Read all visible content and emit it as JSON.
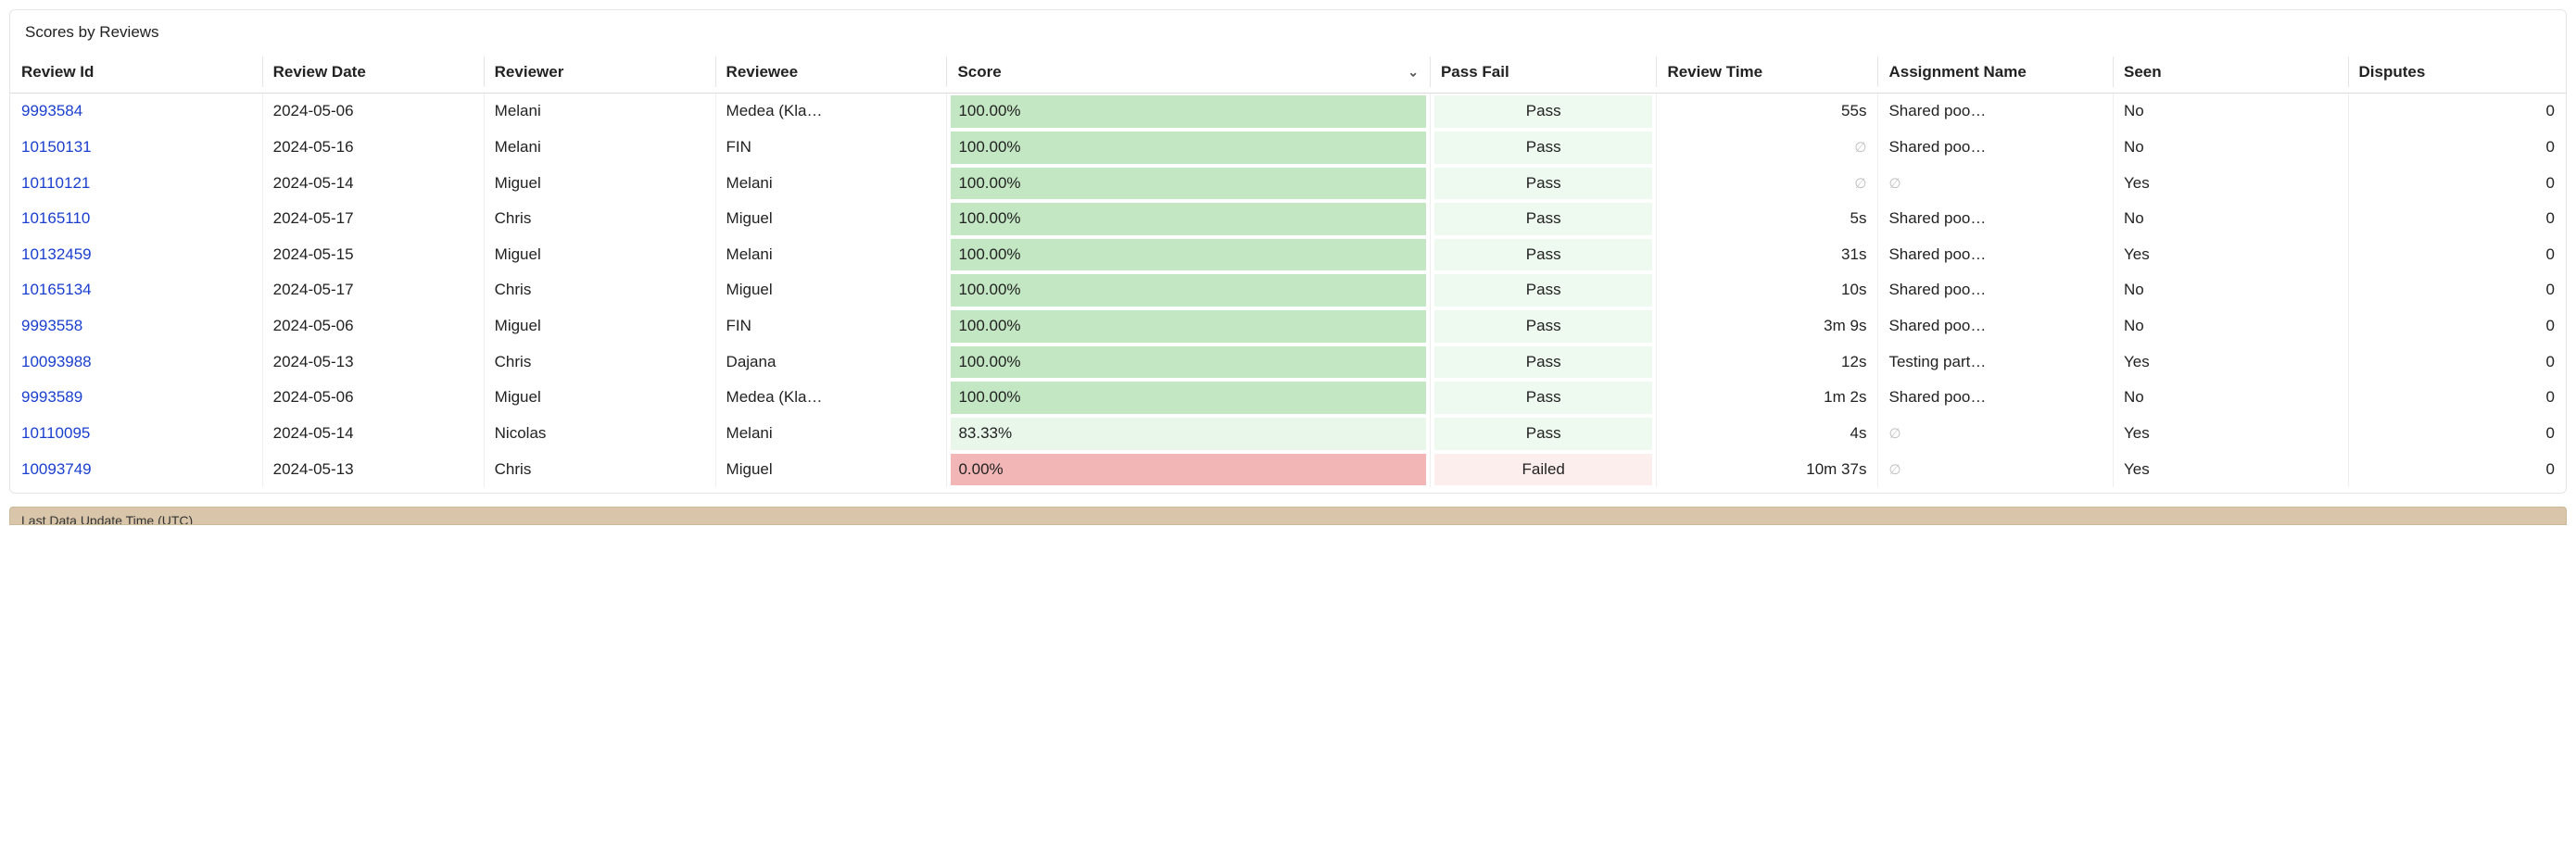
{
  "panel": {
    "title": "Scores by Reviews"
  },
  "columns": [
    {
      "key": "review_id",
      "label": "Review Id",
      "sorted": false,
      "class": "col-reviewid"
    },
    {
      "key": "review_date",
      "label": "Review Date",
      "sorted": false,
      "class": "col-reviewdate"
    },
    {
      "key": "reviewer",
      "label": "Reviewer",
      "sorted": false,
      "class": "col-reviewer"
    },
    {
      "key": "reviewee",
      "label": "Reviewee",
      "sorted": false,
      "class": "col-reviewee"
    },
    {
      "key": "score",
      "label": "Score",
      "sorted": true,
      "class": "col-score"
    },
    {
      "key": "pass_fail",
      "label": "Pass Fail",
      "sorted": false,
      "class": "col-passfail"
    },
    {
      "key": "review_time",
      "label": "Review Time",
      "sorted": false,
      "class": "col-reviewtime"
    },
    {
      "key": "assignment",
      "label": "Assignment Name",
      "sorted": false,
      "class": "col-assignment"
    },
    {
      "key": "seen",
      "label": "Seen",
      "sorted": false,
      "class": "col-seen"
    },
    {
      "key": "disputes",
      "label": "Disputes",
      "sorted": false,
      "class": "col-disputes"
    }
  ],
  "score_colors": {
    "full": {
      "bg": "#c3e6c3"
    },
    "high": {
      "bg": "#e9f6ea"
    },
    "zero": {
      "bg": "#f3b6b6"
    }
  },
  "passfail_colors": {
    "Pass": {
      "bg": "#eef9f0"
    },
    "Failed": {
      "bg": "#fdeeee"
    }
  },
  "rows": [
    {
      "review_id": "9993584",
      "review_date": "2024-05-06",
      "reviewer": "Melani",
      "reviewee": "Medea (Kla…",
      "score": "100.00%",
      "score_tier": "full",
      "pass_fail": "Pass",
      "review_time": "55s",
      "assignment": "Shared poo…",
      "seen": "No",
      "disputes": "0"
    },
    {
      "review_id": "10150131",
      "review_date": "2024-05-16",
      "reviewer": "Melani",
      "reviewee": "FIN",
      "score": "100.00%",
      "score_tier": "full",
      "pass_fail": "Pass",
      "review_time": null,
      "assignment": "Shared poo…",
      "seen": "No",
      "disputes": "0"
    },
    {
      "review_id": "10110121",
      "review_date": "2024-05-14",
      "reviewer": "Miguel",
      "reviewee": "Melani",
      "score": "100.00%",
      "score_tier": "full",
      "pass_fail": "Pass",
      "review_time": null,
      "assignment": null,
      "seen": "Yes",
      "disputes": "0"
    },
    {
      "review_id": "10165110",
      "review_date": "2024-05-17",
      "reviewer": "Chris",
      "reviewee": "Miguel",
      "score": "100.00%",
      "score_tier": "full",
      "pass_fail": "Pass",
      "review_time": "5s",
      "assignment": "Shared poo…",
      "seen": "No",
      "disputes": "0"
    },
    {
      "review_id": "10132459",
      "review_date": "2024-05-15",
      "reviewer": "Miguel",
      "reviewee": "Melani",
      "score": "100.00%",
      "score_tier": "full",
      "pass_fail": "Pass",
      "review_time": "31s",
      "assignment": "Shared poo…",
      "seen": "Yes",
      "disputes": "0"
    },
    {
      "review_id": "10165134",
      "review_date": "2024-05-17",
      "reviewer": "Chris",
      "reviewee": "Miguel",
      "score": "100.00%",
      "score_tier": "full",
      "pass_fail": "Pass",
      "review_time": "10s",
      "assignment": "Shared poo…",
      "seen": "No",
      "disputes": "0"
    },
    {
      "review_id": "9993558",
      "review_date": "2024-05-06",
      "reviewer": "Miguel",
      "reviewee": "FIN",
      "score": "100.00%",
      "score_tier": "full",
      "pass_fail": "Pass",
      "review_time": "3m 9s",
      "assignment": "Shared poo…",
      "seen": "No",
      "disputes": "0"
    },
    {
      "review_id": "10093988",
      "review_date": "2024-05-13",
      "reviewer": "Chris",
      "reviewee": "Dajana",
      "score": "100.00%",
      "score_tier": "full",
      "pass_fail": "Pass",
      "review_time": "12s",
      "assignment": "Testing part…",
      "seen": "Yes",
      "disputes": "0"
    },
    {
      "review_id": "9993589",
      "review_date": "2024-05-06",
      "reviewer": "Miguel",
      "reviewee": "Medea (Kla…",
      "score": "100.00%",
      "score_tier": "full",
      "pass_fail": "Pass",
      "review_time": "1m 2s",
      "assignment": "Shared poo…",
      "seen": "No",
      "disputes": "0"
    },
    {
      "review_id": "10110095",
      "review_date": "2024-05-14",
      "reviewer": "Nicolas",
      "reviewee": "Melani",
      "score": "83.33%",
      "score_tier": "high",
      "pass_fail": "Pass",
      "review_time": "4s",
      "assignment": null,
      "seen": "Yes",
      "disputes": "0"
    },
    {
      "review_id": "10093749",
      "review_date": "2024-05-13",
      "reviewer": "Chris",
      "reviewee": "Miguel",
      "score": "0.00%",
      "score_tier": "zero",
      "pass_fail": "Failed",
      "review_time": "10m 37s",
      "assignment": null,
      "seen": "Yes",
      "disputes": "0"
    }
  ],
  "footer": {
    "label": "Last Data Update Time (UTC)"
  }
}
